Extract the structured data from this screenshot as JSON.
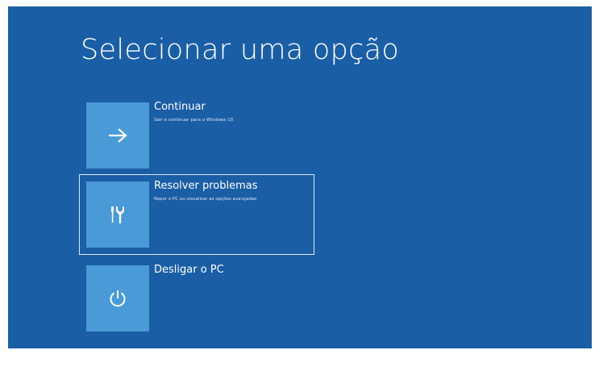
{
  "screen": {
    "title": "Selecionar uma opção",
    "background_color": "#1a5ea6",
    "tile_color": "#4a9ad8"
  },
  "options": [
    {
      "title": "Continuar",
      "description": "Sair e continuar para o Windows 10",
      "icon": "arrow-right-icon",
      "selected": false
    },
    {
      "title": "Resolver problemas",
      "description": "Repor o PC ou visualizar as opções avançadas",
      "icon": "tools-icon",
      "selected": true
    },
    {
      "title": "Desligar o PC",
      "description": "",
      "icon": "power-icon",
      "selected": false
    }
  ]
}
